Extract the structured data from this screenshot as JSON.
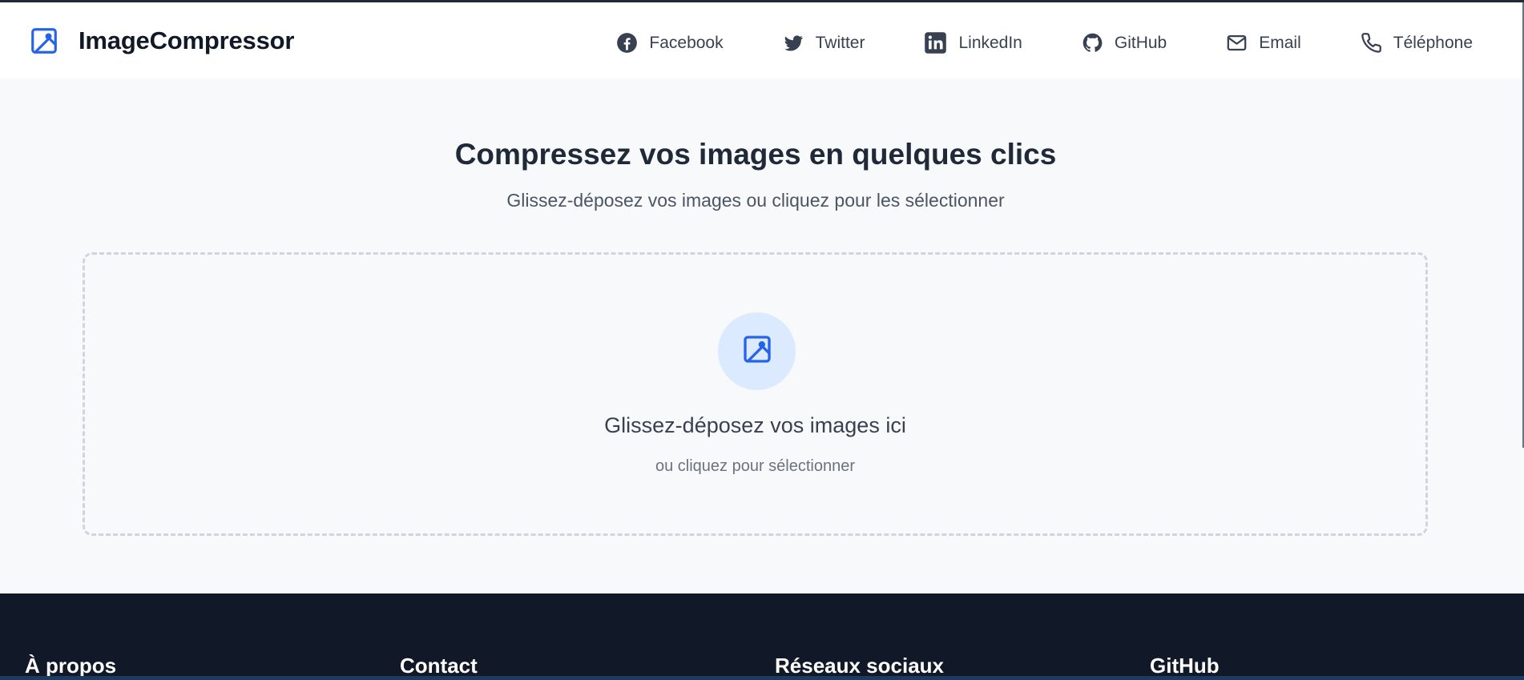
{
  "header": {
    "brand": "ImageCompressor",
    "brand_icon": "image-icon",
    "links": [
      {
        "label": "Facebook",
        "icon": "facebook-icon"
      },
      {
        "label": "Twitter",
        "icon": "twitter-icon"
      },
      {
        "label": "LinkedIn",
        "icon": "linkedin-icon"
      },
      {
        "label": "GitHub",
        "icon": "github-icon"
      },
      {
        "label": "Email",
        "icon": "mail-icon"
      },
      {
        "label": "Téléphone",
        "icon": "phone-icon"
      }
    ]
  },
  "hero": {
    "title": "Compressez vos images en quelques clics",
    "subtitle": "Glissez-déposez vos images ou cliquez pour les sélectionner"
  },
  "dropzone": {
    "icon": "image-icon",
    "title": "Glissez-déposez vos images ici",
    "subtitle": "ou cliquez pour sélectionner"
  },
  "footer": {
    "columns": [
      "À propos",
      "Contact",
      "Réseaux sociaux",
      "GitHub"
    ]
  },
  "colors": {
    "accent": "#2563eb",
    "footer_bg": "#111827",
    "page_bg": "#f8f9fb"
  }
}
